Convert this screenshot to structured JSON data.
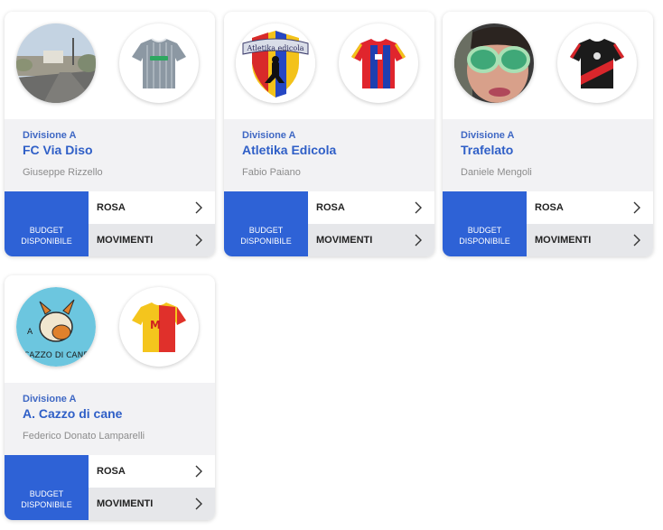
{
  "colors": {
    "accent": "#2e62d6",
    "team_name": "#2f5fc7",
    "info_bg": "#f2f2f4"
  },
  "icons": {
    "chevron": "chevron-right-icon"
  },
  "cards": [
    {
      "division": "Divisione A",
      "team": "FC Via Diso",
      "manager": "Giuseppe Rizzello",
      "avatar": "road-photo",
      "jersey": "grey-white-striped-jersey",
      "budget_label": "BUDGET DISPONIBILE",
      "rosa_label": "ROSA",
      "movimenti_label": "MOVIMENTI"
    },
    {
      "division": "Divisione A",
      "team": "Atletika Edicola",
      "manager": "Fabio Paiano",
      "avatar": "atletika-edicola-crest",
      "avatar_text": "Atletika edicola",
      "jersey": "red-blue-jersey",
      "budget_label": "BUDGET DISPONIBILE",
      "rosa_label": "ROSA",
      "movimenti_label": "MOVIMENTI"
    },
    {
      "division": "Divisione A",
      "team": "Trafelato",
      "manager": "Daniele Mengoli",
      "avatar": "sunglasses-portrait",
      "jersey": "black-red-jersey",
      "budget_label": "BUDGET DISPONIBILE",
      "rosa_label": "ROSA",
      "movimenti_label": "MOVIMENTI"
    },
    {
      "division": "Divisione A",
      "team": "A. Cazzo di cane",
      "manager": "Federico Donato Lamparelli",
      "avatar": "cazzo-di-cane-logo",
      "avatar_text_top": "A",
      "avatar_text_bottom": "CAZZO DI CANE",
      "jersey": "yellow-red-jersey",
      "budget_label": "BUDGET DISPONIBILE",
      "rosa_label": "ROSA",
      "movimenti_label": "MOVIMENTI"
    }
  ]
}
